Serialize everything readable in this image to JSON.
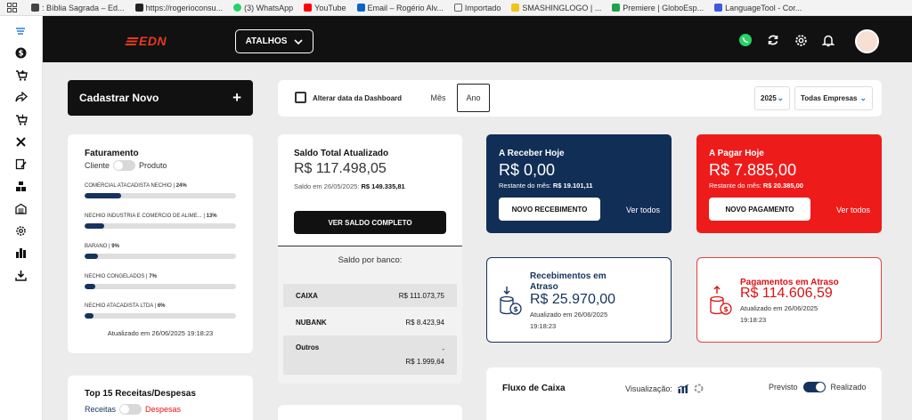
{
  "bookmarks": [
    {
      "label": ": Bíblia Sagrada – Ed...",
      "color": "#444444"
    },
    {
      "label": "https://rogerioconsu...",
      "color": "#222222"
    },
    {
      "label": "(3) WhatsApp",
      "color": "#25d366"
    },
    {
      "label": "YouTube",
      "color": "#ff0000"
    },
    {
      "label": "Email – Rogério Alv...",
      "color": "#0a64c8"
    },
    {
      "label": "Importado",
      "color": "#777777"
    },
    {
      "label": "SMASHINGLOGO | ...",
      "color": "#f0c419"
    },
    {
      "label": "Premiere | GloboEsp...",
      "color": "#1fa34a"
    },
    {
      "label": "LanguageTool - Cor...",
      "color": "#3b5bd8"
    }
  ],
  "header": {
    "logo": "EDN",
    "shortcuts_label": "ATALHOS"
  },
  "new_button": {
    "label": "Cadastrar Novo",
    "plus": "+"
  },
  "date_bar": {
    "label": "Alterar data da Dashboard",
    "tab_month": "Mês",
    "tab_year": "Ano",
    "year_value": "2025",
    "company_value": "Todas Empresas"
  },
  "faturamento": {
    "title": "Faturamento",
    "toggle_left": "Cliente",
    "toggle_right": "Produto",
    "items": [
      {
        "label": "COMERCIAL ATACADISTA NECHIO",
        "pct_text": "24%",
        "pct": 24
      },
      {
        "label": "NECHIO INDUSTRIA E COMERCIO DE ALIME...",
        "pct_text": "13%",
        "pct": 13
      },
      {
        "label": "BARANO",
        "pct_text": "9%",
        "pct": 9
      },
      {
        "label": "NECHIO CONGELADOS",
        "pct_text": "7%",
        "pct": 7
      },
      {
        "label": "NECHIO ATACADISTA LTDA",
        "pct_text": "6%",
        "pct": 6
      }
    ],
    "updated": "Atualizado em 26/06/2025 19:18:23"
  },
  "saldo": {
    "title": "Saldo Total Atualizado",
    "value": "R$ 117.498,05",
    "sub_prefix": "Saldo em 26/05/2025:",
    "sub_value": "R$ 149.335,81",
    "button": "VER SALDO COMPLETO",
    "bank_title": "Saldo por banco:",
    "banks": [
      {
        "name": "CAIXA",
        "value": "R$ 111.073,75"
      },
      {
        "name": "NUBANK",
        "value": "R$ 8.423,94"
      },
      {
        "name": "Outros",
        "value_line1": "-",
        "value": "R$ 1.999,64"
      }
    ]
  },
  "receber_hoje": {
    "title": "A Receber Hoje",
    "value": "R$ 0,00",
    "sub_prefix": "Restante do mês:",
    "sub_value": "R$ 19.101,11",
    "button": "NOVO RECEBIMENTO",
    "link": "Ver todos"
  },
  "pagar_hoje": {
    "title": "A Pagar Hoje",
    "value": "R$ 7.885,00",
    "sub_prefix": "Restante do mês:",
    "sub_value": "R$ 20.385,00",
    "button": "NOVO PAGAMENTO",
    "link": "Ver todos"
  },
  "rec_atraso": {
    "title_line1": "Recebimentos em",
    "title_line2": "Atraso",
    "value": "R$ 25.970,00",
    "updated_line1": "Atualizado em 26/06/2025",
    "updated_line2": "19:18:23"
  },
  "pag_atraso": {
    "title": "Pagamentos em Atraso",
    "value": "R$ 114.606,59",
    "updated_line1": "Atualizado em 26/06/2025",
    "updated_line2": "19:18:23"
  },
  "top15": {
    "title": "Top 15 Receitas/Despesas",
    "left": "Receitas",
    "right": "Despesas"
  },
  "fluxo": {
    "title": "Fluxo de Caixa",
    "vis_label": "Visualização:",
    "prev": "Previsto",
    "real": "Realizado"
  },
  "colors": {
    "navy": "#112e57",
    "red": "#ee1b1b",
    "brand": "#e83a1f"
  }
}
